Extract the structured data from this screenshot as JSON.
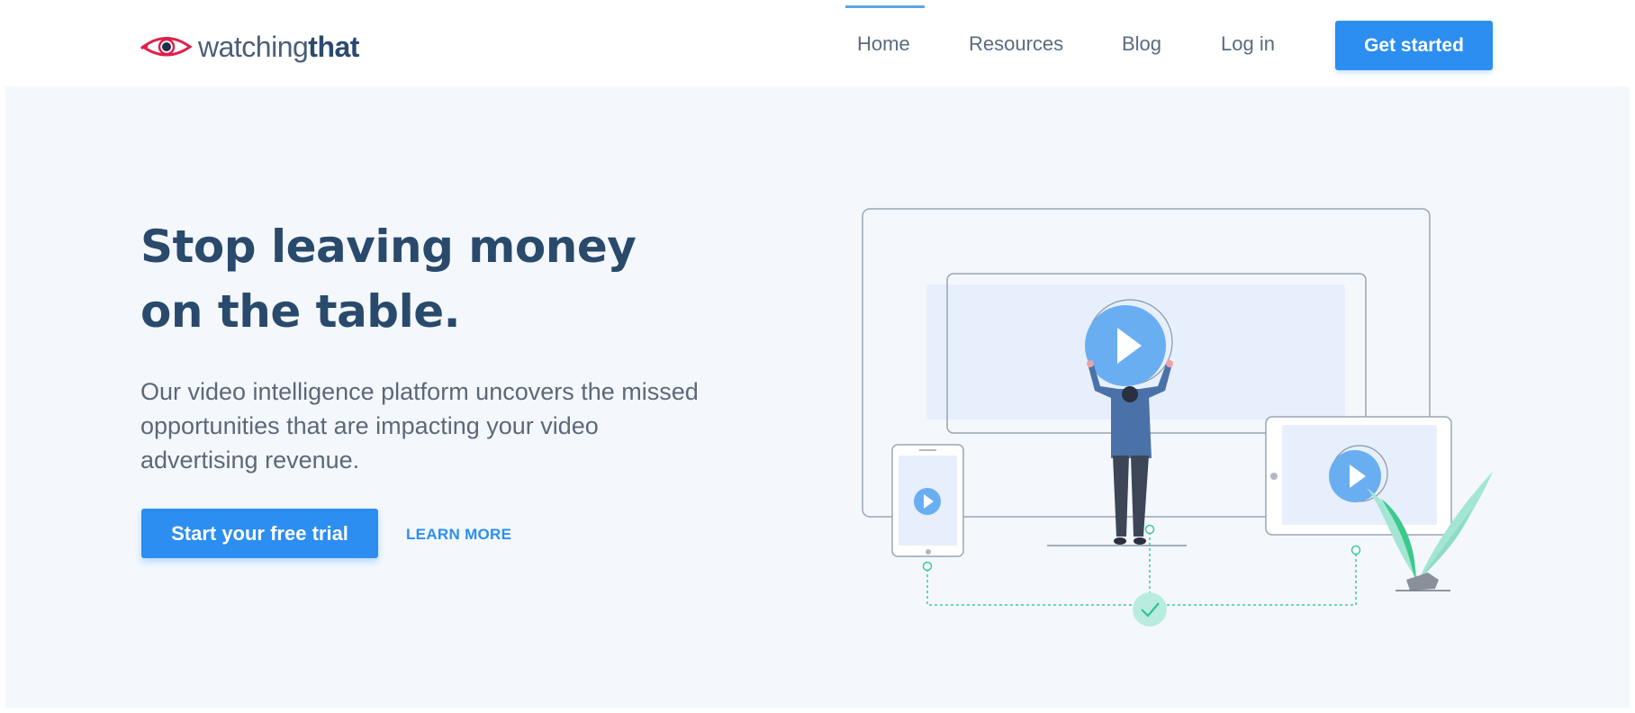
{
  "brand": {
    "name_light": "watching",
    "name_bold": "that",
    "logo_icon": "eye-icon",
    "accent_color": "#e0204a"
  },
  "nav": {
    "items": [
      {
        "label": "Home",
        "active": true
      },
      {
        "label": "Resources",
        "active": false
      },
      {
        "label": "Blog",
        "active": false
      },
      {
        "label": "Log in",
        "active": false
      }
    ],
    "cta_label": "Get started"
  },
  "hero": {
    "title_line1": "Stop leaving money",
    "title_line2": "on the table.",
    "subtitle": "Our video intelligence platform uncovers the missed opportunities that are impacting your video advertising revenue.",
    "primary_cta": "Start your free trial",
    "secondary_cta": "LEARN MORE"
  },
  "colors": {
    "primary": "#2b8ef0",
    "heading": "#2a4a6c",
    "background": "#f4f8fd",
    "play_blue": "#6aaef2",
    "check_green": "#3cc99a"
  },
  "illustration": {
    "icons": [
      "play-icon",
      "check-icon",
      "plant-icon",
      "person-figure"
    ]
  }
}
